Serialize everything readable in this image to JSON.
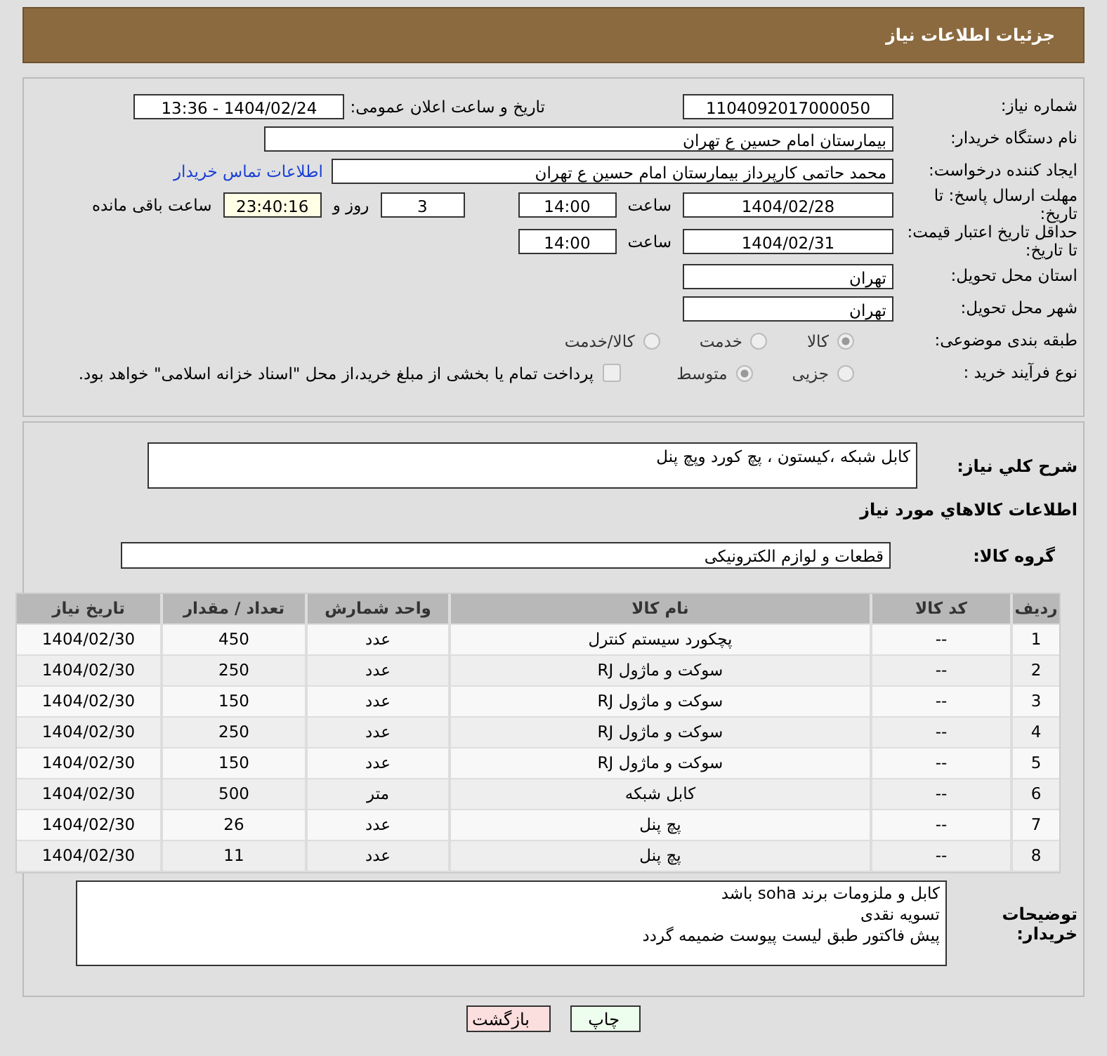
{
  "header": {
    "title": "جزئیات اطلاعات نیاز"
  },
  "details": {
    "need_number": {
      "label": "شماره نیاز:",
      "value": "1104092017000050"
    },
    "announce": {
      "label": "تاریخ و ساعت اعلان عمومی:",
      "value": "1404/02/24 - 13:36"
    },
    "buyer_org": {
      "label": "نام دستگاه خریدار:",
      "value": "بیمارستان امام حسین  ع  تهران"
    },
    "requester": {
      "label": "ایجاد کننده درخواست:",
      "value": "محمد حاتمی کارپرداز بیمارستان امام حسین  ع  تهران",
      "link": "اطلاعات تماس خریدار"
    },
    "deadline": {
      "label": "مهلت ارسال پاسخ: تا تاریخ:",
      "date": "1404/02/28",
      "time_label": "ساعت",
      "time": "14:00",
      "days": "3",
      "days_label": "روز و",
      "remaining": "23:40:16",
      "remaining_label": "ساعت باقی مانده"
    },
    "validity": {
      "label": "حداقل تاریخ اعتبار قیمت: تا تاریخ:",
      "date": "1404/02/31",
      "time_label": "ساعت",
      "time": "14:00"
    },
    "province": {
      "label": "استان محل تحویل:",
      "value": "تهران"
    },
    "city": {
      "label": "شهر محل تحویل:",
      "value": "تهران"
    },
    "category": {
      "label": "طبقه بندی موضوعی:",
      "options": [
        {
          "label": "کالا",
          "selected": true
        },
        {
          "label": "خدمت",
          "selected": false
        },
        {
          "label": "کالا/خدمت",
          "selected": false
        }
      ]
    },
    "process": {
      "label": "نوع فرآیند خرید :",
      "options": [
        {
          "label": "جزیی",
          "selected": false
        },
        {
          "label": "متوسط",
          "selected": true
        }
      ],
      "payment": {
        "label": "پرداخت تمام یا بخشی از مبلغ خرید،از محل \"اسناد خزانه اسلامی\" خواهد بود.",
        "checked": false
      }
    }
  },
  "summary": {
    "label": "شرح کلي نياز:",
    "value": "کابل شبکه ،کیستون ، پچ کورد وپچ پنل"
  },
  "goods_title": "اطلاعات کالاهاي مورد نياز",
  "group": {
    "label": "گروه کالا:",
    "value": "قطعات و لوازم الکترونیکی"
  },
  "table": {
    "columns": [
      "ردیف",
      "کد کالا",
      "نام کالا",
      "واحد شمارش",
      "تعداد / مقدار",
      "تاریخ نیاز"
    ],
    "rows": [
      [
        "1",
        "--",
        "پچکورد سیستم کنترل",
        "عدد",
        "450",
        "1404/02/30"
      ],
      [
        "2",
        "--",
        "سوکت و ماژول RJ",
        "عدد",
        "250",
        "1404/02/30"
      ],
      [
        "3",
        "--",
        "سوکت و ماژول RJ",
        "عدد",
        "150",
        "1404/02/30"
      ],
      [
        "4",
        "--",
        "سوکت و ماژول RJ",
        "عدد",
        "250",
        "1404/02/30"
      ],
      [
        "5",
        "--",
        "سوکت و ماژول RJ",
        "عدد",
        "150",
        "1404/02/30"
      ],
      [
        "6",
        "--",
        "کابل شبکه",
        "متر",
        "500",
        "1404/02/30"
      ],
      [
        "7",
        "--",
        "پچ پنل",
        "عدد",
        "26",
        "1404/02/30"
      ],
      [
        "8",
        "--",
        "پچ پنل",
        "عدد",
        "11",
        "1404/02/30"
      ]
    ]
  },
  "notes": {
    "label": "توضیحات خریدار:",
    "lines": [
      "کابل و ملزومات برند soha باشد",
      "تسویه نقدی",
      "پیش فاکتور  طبق لیست  پیوست ضمیمه گردد"
    ]
  },
  "buttons": [
    {
      "label": "چاپ",
      "kind": "print"
    },
    {
      "label": "بازگشت",
      "kind": "back"
    }
  ]
}
